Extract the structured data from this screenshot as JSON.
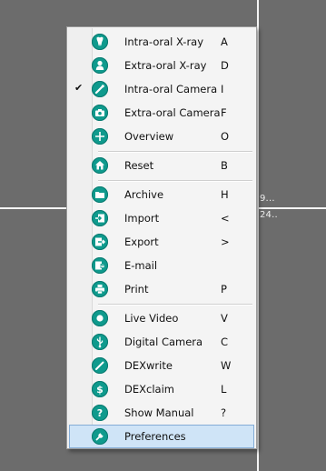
{
  "background": {
    "side_values": [
      "9...",
      "24.."
    ]
  },
  "menu": {
    "items": [
      {
        "label": "Intra-oral X-ray",
        "key": "A",
        "icon": "tooth-icon",
        "checked": false,
        "selected": false
      },
      {
        "label": "Extra-oral X-ray",
        "key": "D",
        "icon": "head-scan-icon",
        "checked": false,
        "selected": false
      },
      {
        "label": "Intra-oral Camera",
        "key": "I",
        "icon": "intraoral-camera-icon",
        "checked": true,
        "selected": false
      },
      {
        "label": "Extra-oral Camera",
        "key": "F",
        "icon": "camera-icon",
        "checked": false,
        "selected": false
      },
      {
        "label": "Overview",
        "key": "O",
        "icon": "crosshair-icon",
        "checked": false,
        "selected": false
      },
      {
        "label": "Reset",
        "key": "B",
        "icon": "home-icon",
        "checked": false,
        "selected": false
      },
      {
        "label": "Archive",
        "key": "H",
        "icon": "folder-icon",
        "checked": false,
        "selected": false
      },
      {
        "label": "Import",
        "key": "<",
        "icon": "import-icon",
        "checked": false,
        "selected": false
      },
      {
        "label": "Export",
        "key": ">",
        "icon": "export-icon",
        "checked": false,
        "selected": false
      },
      {
        "label": "E-mail",
        "key": "",
        "icon": "email-icon",
        "checked": false,
        "selected": false
      },
      {
        "label": "Print",
        "key": "P",
        "icon": "printer-icon",
        "checked": false,
        "selected": false
      },
      {
        "label": "Live Video",
        "key": "V",
        "icon": "record-icon",
        "checked": false,
        "selected": false
      },
      {
        "label": "Digital Camera",
        "key": "C",
        "icon": "usb-icon",
        "checked": false,
        "selected": false
      },
      {
        "label": "DEXwrite",
        "key": "W",
        "icon": "pen-icon",
        "checked": false,
        "selected": false
      },
      {
        "label": "DEXclaim",
        "key": "L",
        "icon": "dollar-icon",
        "checked": false,
        "selected": false
      },
      {
        "label": "Show Manual",
        "key": "?",
        "icon": "help-icon",
        "checked": false,
        "selected": false
      },
      {
        "label": "Preferences",
        "key": "",
        "icon": "wrench-icon",
        "checked": false,
        "selected": true
      }
    ],
    "check_glyph": "✔"
  },
  "colors": {
    "icon_fill": "#0f9a8d",
    "selection_bg": "#cfe4f7",
    "selection_border": "#84acd6",
    "background": "#6c6c6c"
  }
}
